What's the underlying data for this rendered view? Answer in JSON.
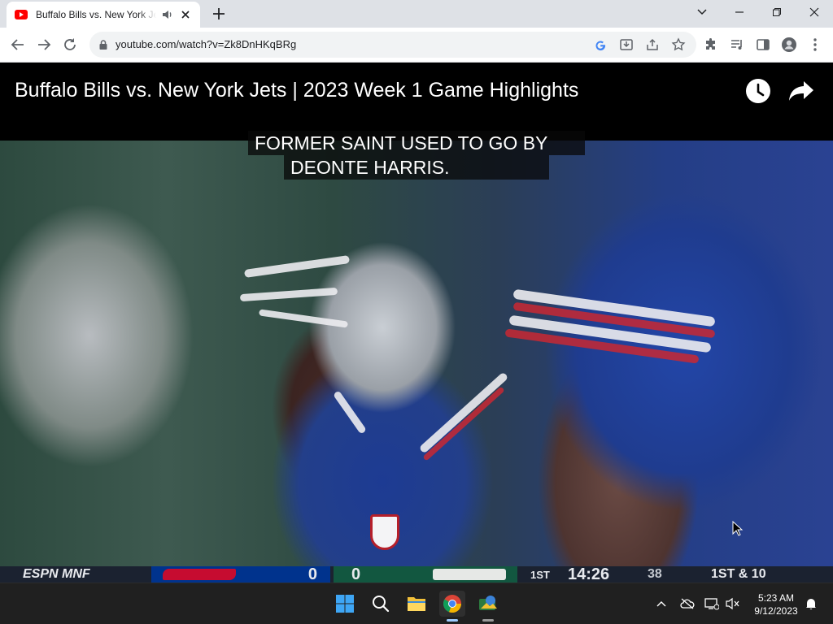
{
  "browser": {
    "tab": {
      "title": "Buffalo Bills vs. New York Jets | 2023 Week 1 Game Highlights"
    },
    "omnibox": {
      "url": "youtube.com/watch?v=Zk8DnHKqBRg"
    }
  },
  "video": {
    "title": "Buffalo Bills vs. New York Jets | 2023 Week 1 Game Highlights",
    "captions": [
      "FORMER SAINT USED TO GO BY",
      "DEONTE HARRIS."
    ],
    "scorebug": {
      "network": "ESPN MNF",
      "away_score": "0",
      "home_score": "0",
      "quarter": "1ST",
      "game_clock": "14:26",
      "play_clock": "38",
      "down_distance": "1ST & 10"
    }
  },
  "taskbar": {
    "time": "5:23 AM",
    "date": "9/12/2023"
  },
  "colors": {
    "youtube_red": "#ff0000",
    "tabstrip": "#dee1e6",
    "taskbar": "#202020",
    "bills_blue": "#00338d",
    "bills_red": "#c60c30"
  }
}
